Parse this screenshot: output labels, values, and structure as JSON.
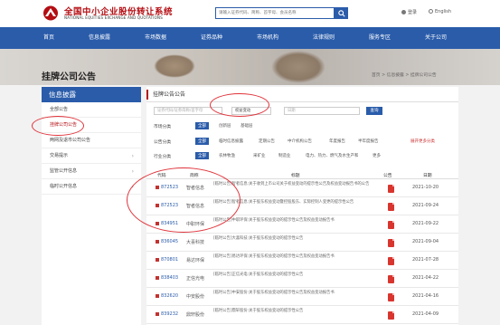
{
  "header": {
    "logo_cn": "全国中小企业股份转让系统",
    "logo_en": "NATIONAL EQUITIES EXCHANGE AND QUOTATIONS",
    "search_placeholder": "请输入证券代码、简称、首字母、会员名称",
    "search_button_icon": "search-icon",
    "login_label": "登录",
    "english_label": "English"
  },
  "nav": {
    "items": [
      "首页",
      "信息披露",
      "市场数据",
      "证券品种",
      "市场机构",
      "法律规则",
      "服务专区",
      "关于公司"
    ]
  },
  "page": {
    "title": "挂牌公司公告",
    "breadcrumb": "首页 > 信息披露 > 挂牌公司公告"
  },
  "sidebar": {
    "heading": "信息披露",
    "items": [
      {
        "label": "全部公告",
        "active": false,
        "arrow": false
      },
      {
        "label": "挂牌公司公告",
        "active": true,
        "arrow": false
      },
      {
        "label": "两网及退市公司公告",
        "active": false,
        "arrow": false
      },
      {
        "label": "交易提示",
        "active": false,
        "arrow": true
      },
      {
        "label": "监管公开信息",
        "active": false,
        "arrow": true
      },
      {
        "label": "临时公开信息",
        "active": false,
        "arrow": true
      }
    ]
  },
  "main": {
    "heading": "挂牌公告公告",
    "filters": {
      "code_placeholder": "证券代码/证券简称/首字母",
      "keyword_value": "权益变动",
      "date_placeholder": "日期",
      "query_label": "查询"
    },
    "filter_rows": [
      {
        "label": "市场分类",
        "options": [
          "全部",
          "创新层",
          "基础层"
        ],
        "selected": 0,
        "more": ""
      },
      {
        "label": "公告分类",
        "options": [
          "全部",
          "临时信息披露",
          "定期公告",
          "中介机构公告",
          "年度报告",
          "半年度报告"
        ],
        "selected": 0,
        "more": "展开更多分类"
      },
      {
        "label": "行业分类",
        "options": [
          "全部",
          "农林牧渔",
          "采矿业",
          "制造业",
          "电力、热力、燃气及水生产和供应业",
          "更多"
        ],
        "selected": 0,
        "more": ""
      }
    ],
    "table": {
      "headers": [
        "代码",
        "简称",
        "标题",
        "公告",
        "日期"
      ],
      "rows": [
        {
          "code": "872523",
          "name": "智者信息",
          "title": "[临时公告]智者信息:关于收到上市公司关于权益变动的提示性公告及权益变动报告书的公告",
          "date": "2021-10-20"
        },
        {
          "code": "872523",
          "name": "智者信息",
          "title": "[临时公告]智者信息:关于股东权益变动暨控股股东、实际控制人变更的提示性公告",
          "date": "2021-09-24"
        },
        {
          "code": "834951",
          "name": "中职环保",
          "title": "[临时公告]中职环保:关于股东权益变动的提示性公告及权益变动报告书",
          "date": "2021-09-22"
        },
        {
          "code": "836045",
          "name": "大喜科技",
          "title": "[临时公告]大喜科技:关于股东权益变动的提示性公告",
          "date": "2021-09-04"
        },
        {
          "code": "870801",
          "name": "易达环保",
          "title": "[临时公告]易达环保:关于股东权益变动的提示性公告及权益变动报告书",
          "date": "2021-07-28"
        },
        {
          "code": "838403",
          "name": "正信光电",
          "title": "[临时公告]正信光电:关于股东权益变动的提示性公告",
          "date": "2021-04-22"
        },
        {
          "code": "832620",
          "name": "中安股份",
          "title": "[临时公告]中安股份:关于股东权益变动的提示性公告及权益变动报告书",
          "date": "2021-04-16"
        },
        {
          "code": "839232",
          "name": "鼎轩股份",
          "title": "[临时公告]鼎轩股份:关于股东权益变动的提示性公告",
          "date": "2021-04-09"
        }
      ]
    }
  },
  "colors": {
    "brand_blue": "#2a5caa",
    "brand_red": "#b30d12",
    "annotation_red": "#e0333a"
  }
}
